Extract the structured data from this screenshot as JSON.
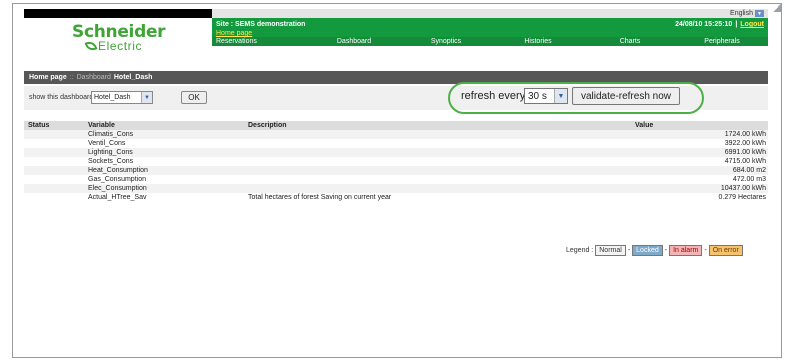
{
  "header": {
    "language": "English",
    "logo": {
      "line1": "Schneider",
      "line2": "Electric"
    },
    "site": "Site : SEMS demonstration",
    "home_link": "Home page",
    "datetime": "24/08/10 15:25:10",
    "separator": "|",
    "logout": "Logout"
  },
  "nav": [
    "Reservations",
    "Dashboard",
    "Synoptics",
    "Histories",
    "Charts",
    "Peripherals"
  ],
  "breadcrumb": {
    "home": "Home page",
    "sep": "::",
    "section": "Dashboard",
    "current": "Hotel_Dash"
  },
  "controls": {
    "show_label": "show this dashboard",
    "dashboard_value": "Hotel_Dash",
    "ok_label": "OK",
    "refresh_label": "refresh every",
    "refresh_value": "30 s",
    "validate_label": "validate-refresh now"
  },
  "table": {
    "headers": {
      "status": "Status",
      "variable": "Variable",
      "description": "Description",
      "value": "Value"
    },
    "rows": [
      {
        "status": "",
        "variable": "Climatis_Cons",
        "description": "",
        "value": "1724.00 kWh"
      },
      {
        "status": "",
        "variable": "Ventil_Cons",
        "description": "",
        "value": "3922.00 kWh"
      },
      {
        "status": "",
        "variable": "Lighting_Cons",
        "description": "",
        "value": "6991.00 kWh"
      },
      {
        "status": "",
        "variable": "Sockets_Cons",
        "description": "",
        "value": "4715.00 kWh"
      },
      {
        "status": "",
        "variable": "Heat_Consumption",
        "description": "",
        "value": "684.00 m2"
      },
      {
        "status": "",
        "variable": "Gas_Consumption",
        "description": "",
        "value": "472.00 m3"
      },
      {
        "status": "",
        "variable": "Elec_Consumption",
        "description": "",
        "value": "10437.00 kWh"
      },
      {
        "status": "",
        "variable": "Actual_HTree_Sav",
        "description": "Total hectares of forest Saving on current year",
        "value": "0.279 Hectares"
      }
    ]
  },
  "legend": {
    "label": "Legend :",
    "sep": "-",
    "normal": "Normal",
    "locked": "Locked",
    "alarm": "In alarm",
    "error": "On error"
  },
  "colors": {
    "brand_green": "#3fa535",
    "header_green": "#149a3e",
    "highlight_oval": "#4db046",
    "link_yellow": "#ffe84a"
  }
}
